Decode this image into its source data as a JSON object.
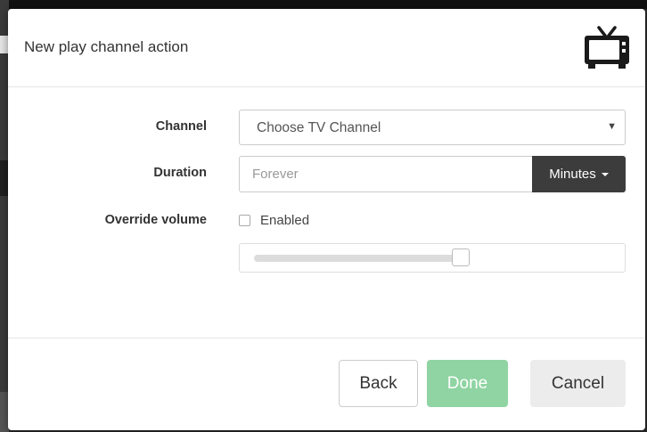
{
  "dialog": {
    "title": "New play channel action",
    "header_icon": "tv-icon"
  },
  "form": {
    "channel": {
      "label": "Channel",
      "selected": "Choose TV Channel"
    },
    "duration": {
      "label": "Duration",
      "placeholder": "Forever",
      "unit_button": "Minutes"
    },
    "override_volume": {
      "label": "Override volume",
      "checkbox_label": "Enabled",
      "checked": false,
      "slider_level_fraction": 0.58
    }
  },
  "footer": {
    "back_label": "Back",
    "done_label": "Done",
    "cancel_label": "Cancel"
  },
  "colors": {
    "done_button": "#8fd4a2",
    "units_button": "#3c3c3c",
    "cancel_button": "#ececec"
  }
}
